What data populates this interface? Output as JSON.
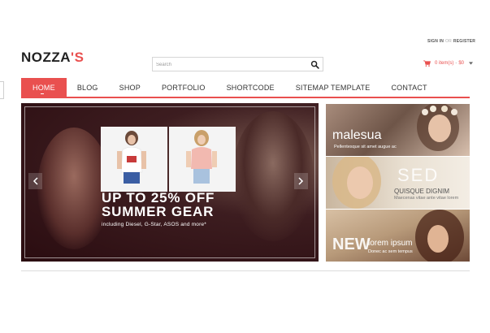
{
  "header": {
    "sign_in": "SIGN IN",
    "or": "OR",
    "register": "REGISTER",
    "logo_main": "NOZZA",
    "logo_accent": "'S"
  },
  "search": {
    "placeholder": "Search"
  },
  "cart": {
    "items": "0 item(s)",
    "sep": "-",
    "price": "$0"
  },
  "nav": {
    "items": [
      "HOME",
      "BLOG",
      "SHOP",
      "PORTFOLIO",
      "SHORTCODE",
      "SITEMAP TEMPLATE",
      "CONTACT"
    ],
    "active_index": 0
  },
  "slider": {
    "headline_1": "UP TO 25% OFF",
    "headline_2": "SUMMER GEAR",
    "sub": "including Diesel, G-Star, ASOS and more*"
  },
  "promos": [
    {
      "title": "malesua",
      "caption": "Pellentesque sit amet augue ac"
    },
    {
      "title": "SED",
      "subtitle": "QUISQUE DIGNIM",
      "caption": "Maecenas vitae ante vitae lorem"
    },
    {
      "title": "NEW",
      "title2": "lorem ipsum",
      "caption": "Donec ac sem tempus"
    }
  ],
  "colors": {
    "accent": "#e9504f",
    "text": "#333333",
    "border": "#d6d6d6"
  },
  "icons": {
    "search": "search-icon",
    "cart": "cart-icon",
    "caret": "caret-down-icon"
  }
}
